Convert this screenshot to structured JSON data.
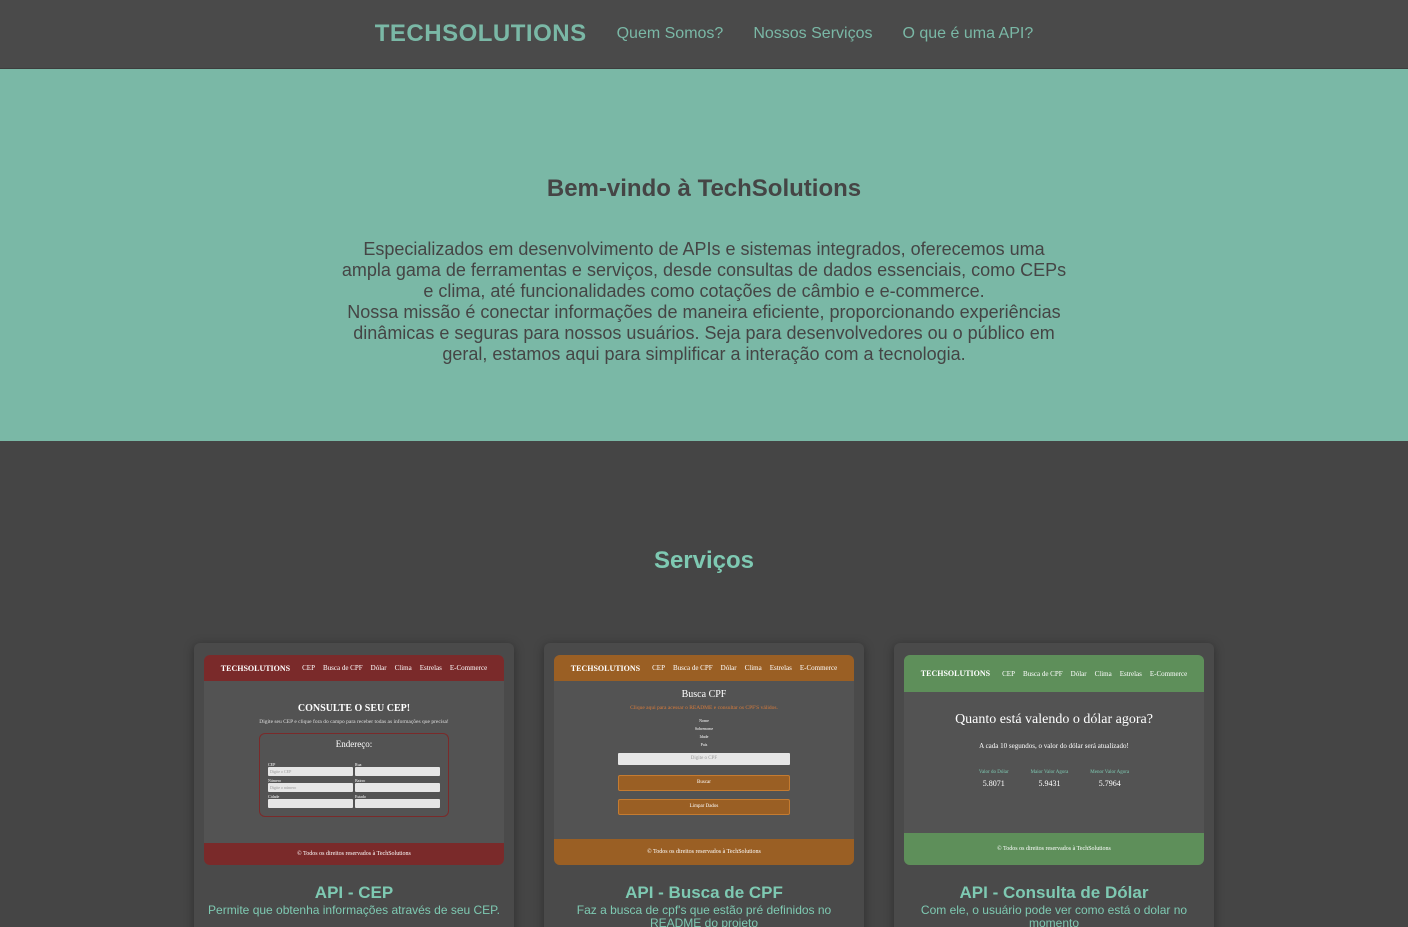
{
  "nav": {
    "brand": "TECHSOLUTIONS",
    "links": [
      "Quem Somos?",
      "Nossos Serviços",
      "O que é uma API?"
    ]
  },
  "hero": {
    "title": "Bem-vindo à TechSolutions",
    "paragraph1": "Especializados em desenvolvimento de APIs e sistemas integrados, oferecemos uma ampla gama de ferramentas e serviços, desde consultas de dados essenciais, como CEPs e clima, até funcionalidades como cotações de câmbio e e-commerce.",
    "paragraph2": "Nossa missão é conectar informações de maneira eficiente, proporcionando experiências dinâmicas e seguras para nossos usuários. Seja para desenvolvedores ou o público em geral, estamos aqui para simplificar a interação com a tecnologia."
  },
  "services": {
    "title": "Serviços",
    "cards": [
      {
        "title": "API - CEP",
        "description": "Permite que obtenha informações através de seu CEP.",
        "thumb": {
          "nav_brand": "TECHSOLUTIONS",
          "nav_links": [
            "CEP",
            "Busca de CPF",
            "Dólar",
            "Clima",
            "Estrelas",
            "E-Commerce"
          ],
          "heading": "CONSULTE O SEU CEP!",
          "subheading": "Digite seu CEP e clique fora do campo para receber todas as informações que precisa!",
          "legend": "Endereço:",
          "fields": [
            {
              "label": "CEP",
              "placeholder": "Digite o CEP"
            },
            {
              "label": "Rua",
              "placeholder": ""
            },
            {
              "label": "Número",
              "placeholder": "Digite o número"
            },
            {
              "label": "Bairro",
              "placeholder": ""
            },
            {
              "label": "Cidade",
              "placeholder": ""
            },
            {
              "label": "Estado",
              "placeholder": ""
            }
          ],
          "footer": "© Todos os direitos reservados à TechSolutions"
        }
      },
      {
        "title": "API - Busca de CPF",
        "description": "Faz a busca de cpf's que estão pré definidos no README do projeto",
        "thumb": {
          "nav_brand": "TECHSOLUTIONS",
          "nav_links": [
            "CEP",
            "Busca de CPF",
            "Dólar",
            "Clima",
            "Estrelas",
            "E-Commerce"
          ],
          "heading": "Busca CPF",
          "notice": "Clique aqui para acessar o README e consultar os CPF'S válidos.",
          "fields": [
            "Nome",
            "Sobrenome",
            "Idade",
            "País"
          ],
          "input_placeholder": "Digite o CPF",
          "search_label": "Buscar",
          "clear_label": "Limpar Dados",
          "footer": "© Todos os direitos reservados à TechSolutions"
        }
      },
      {
        "title": "API - Consulta de Dólar",
        "description": "Com ele, o usuário pode ver como está o dolar no momento",
        "thumb": {
          "nav_brand": "TECHSOLUTIONS",
          "nav_links": [
            "CEP",
            "Busca de CPF",
            "Dólar",
            "Clima",
            "Estrelas",
            "E-Commerce"
          ],
          "heading": "Quanto está valendo o dólar agora?",
          "subheading": "A cada 10 segundos, o valor do dólar será atualizado!",
          "values": [
            {
              "label": "Valor do Dólar",
              "value": "5.8071"
            },
            {
              "label": "Maior Valor Agora",
              "value": "5.9431"
            },
            {
              "label": "Menor Valor Agora",
              "value": "5.7964"
            }
          ],
          "footer": "© Todos os direitos reservados à TechSolutions"
        }
      }
    ]
  },
  "colors": {
    "accent": "#7ab8a6",
    "dark": "#454545",
    "cep": "#7a2a2a",
    "cpf": "#9a5f24",
    "dolar": "#5e8f5a"
  }
}
